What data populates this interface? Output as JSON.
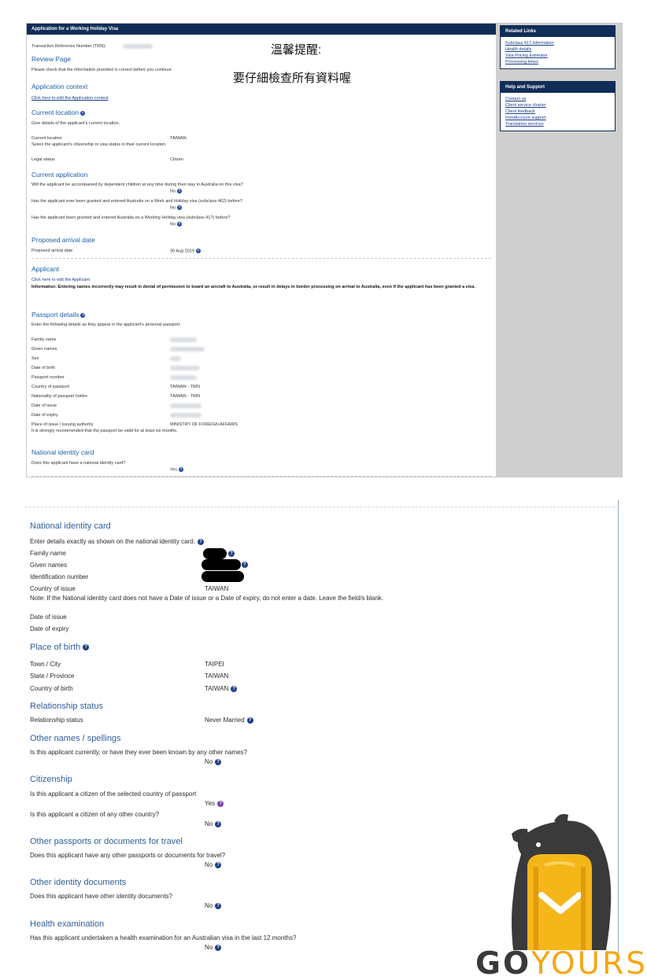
{
  "top": {
    "header": "Application for a Working Holiday Visa",
    "trn_label": "Transaction Reference Number (TRN):",
    "overlay": {
      "line1": "溫馨提醒:",
      "line2": "要仔細檢查所有資料喔"
    },
    "review": {
      "title": "Review Page",
      "desc": "Please check that the information provided is correct before you continue."
    },
    "context": {
      "title": "Application context",
      "link": "Click here to edit the Application context"
    },
    "location": {
      "title": "Current location",
      "desc": "Give details of the applicant's current location.",
      "current_label": "Current location",
      "current_value": "TAIWAN",
      "select_text": "Select the applicant's citizenship or visa status in their current location.",
      "legal_label": "Legal status",
      "legal_value": "Citizen"
    },
    "current_app": {
      "title": "Current application",
      "q1": "Will the applicant be accompanied by dependent children at any time during their stay in Australia on this visa?",
      "a1": "No",
      "q2": "Has the applicant ever been granted and entered Australia on a Work and Holiday visa (subclass 462) before?",
      "a2": "No",
      "q3": "Has the applicant been granted and entered Australia on a Working Holiday visa (subclass 417) before?",
      "a3": "No"
    },
    "arrival": {
      "title": "Proposed arrival date",
      "label": "Proposed arrival date",
      "value": "30 Aug 2019"
    },
    "applicant": {
      "title": "Applicant",
      "link": "Click here to edit the Applicant",
      "info": "Information: Entering names incorrectly may result in denial of permission to board an aircraft to Australia, or result in delays in border processing on arrival to Australia, even if the applicant has been granted a visa."
    },
    "passport": {
      "title": "Passport details",
      "desc": "Enter the following details as they appear in the applicant's personal passport.",
      "rows": [
        {
          "label": "Family name",
          "value": ""
        },
        {
          "label": "Given names",
          "value": ""
        },
        {
          "label": "Sex",
          "value": ""
        },
        {
          "label": "Date of birth",
          "value": ""
        },
        {
          "label": "Passport number",
          "value": ""
        },
        {
          "label": "Country of passport",
          "value": "TAIWAN - TWN"
        },
        {
          "label": "Nationality of passport holder",
          "value": "TAIWAN - TWN"
        },
        {
          "label": "Date of issue",
          "value": ""
        },
        {
          "label": "Date of expiry",
          "value": ""
        },
        {
          "label": "Place of issue / issuing authority",
          "value": "MINISTRY OF FOREIGN AFFAIRS"
        }
      ],
      "note": "It is strongly recommended that the passport be valid for at least six months."
    },
    "nid": {
      "title": "National identity card",
      "question": "Does this applicant have a national identity card?",
      "answer": "Yes"
    },
    "sidebar": {
      "related_title": "Related Links",
      "related_links": [
        "Subclass 417 information",
        "Health details",
        "Visa Pricing Estimator",
        "Processing times"
      ],
      "help_title": "Help and Support",
      "help_links": [
        "Contact us",
        "Client service charter",
        "Client feedback",
        "ImmiAccount support",
        "Translation services"
      ]
    }
  },
  "bottom": {
    "nid": {
      "title": "National identity card",
      "desc": "Enter details exactly as shown on the national identity card.",
      "family_label": "Family name",
      "given_label": "Given names",
      "id_label": "Identification number",
      "country_label": "Country of issue",
      "country_value": "TAIWAN",
      "note": "Note: If the National identity card does not have a Date of issue or a Date of expiry, do not enter a date. Leave the field/s blank.",
      "issue_label": "Date of issue",
      "expiry_label": "Date of expiry"
    },
    "birth": {
      "title": "Place of birth",
      "town_label": "Town / City",
      "town_value": "TAIPEI",
      "state_label": "State / Province",
      "state_value": "TAIWAN",
      "country_label": "Country of birth",
      "country_value": "TAIWAN"
    },
    "relationship": {
      "title": "Relationship status",
      "label": "Relationship status",
      "value": "Never Married"
    },
    "other_names": {
      "title": "Other names / spellings",
      "question": "Is this applicant currently, or have they ever been known by any other names?",
      "answer": "No"
    },
    "citizenship": {
      "title": "Citizenship",
      "q1": "Is this applicant a citizen of the selected country of passport",
      "a1": "Yes",
      "q2": "Is this applicant a citizen of any other country?",
      "a2": "No"
    },
    "other_passports": {
      "title": "Other passports or documents for travel",
      "question": "Does this applicant have any other passports or documents for travel?",
      "answer": "No"
    },
    "other_ids": {
      "title": "Other identity documents",
      "question": "Does this applicant have other identity documents?",
      "answer": "No"
    },
    "health": {
      "title": "Health examination",
      "question": "Has this applicant undertaken a health examination for an Australian visa in the last 12 months?",
      "answer": "No"
    }
  },
  "logo": {
    "go": "GO",
    "yours": "YOURS"
  },
  "help_glyph": "?",
  "colors": {
    "header_navy": "#0f2d57",
    "heading_blue": "#2f5f9e",
    "logo_yellow": "#f5b61a",
    "logo_gray": "#3a3a3a"
  },
  "icons": [
    "help-icon",
    "bear-icon",
    "backpack-icon"
  ]
}
